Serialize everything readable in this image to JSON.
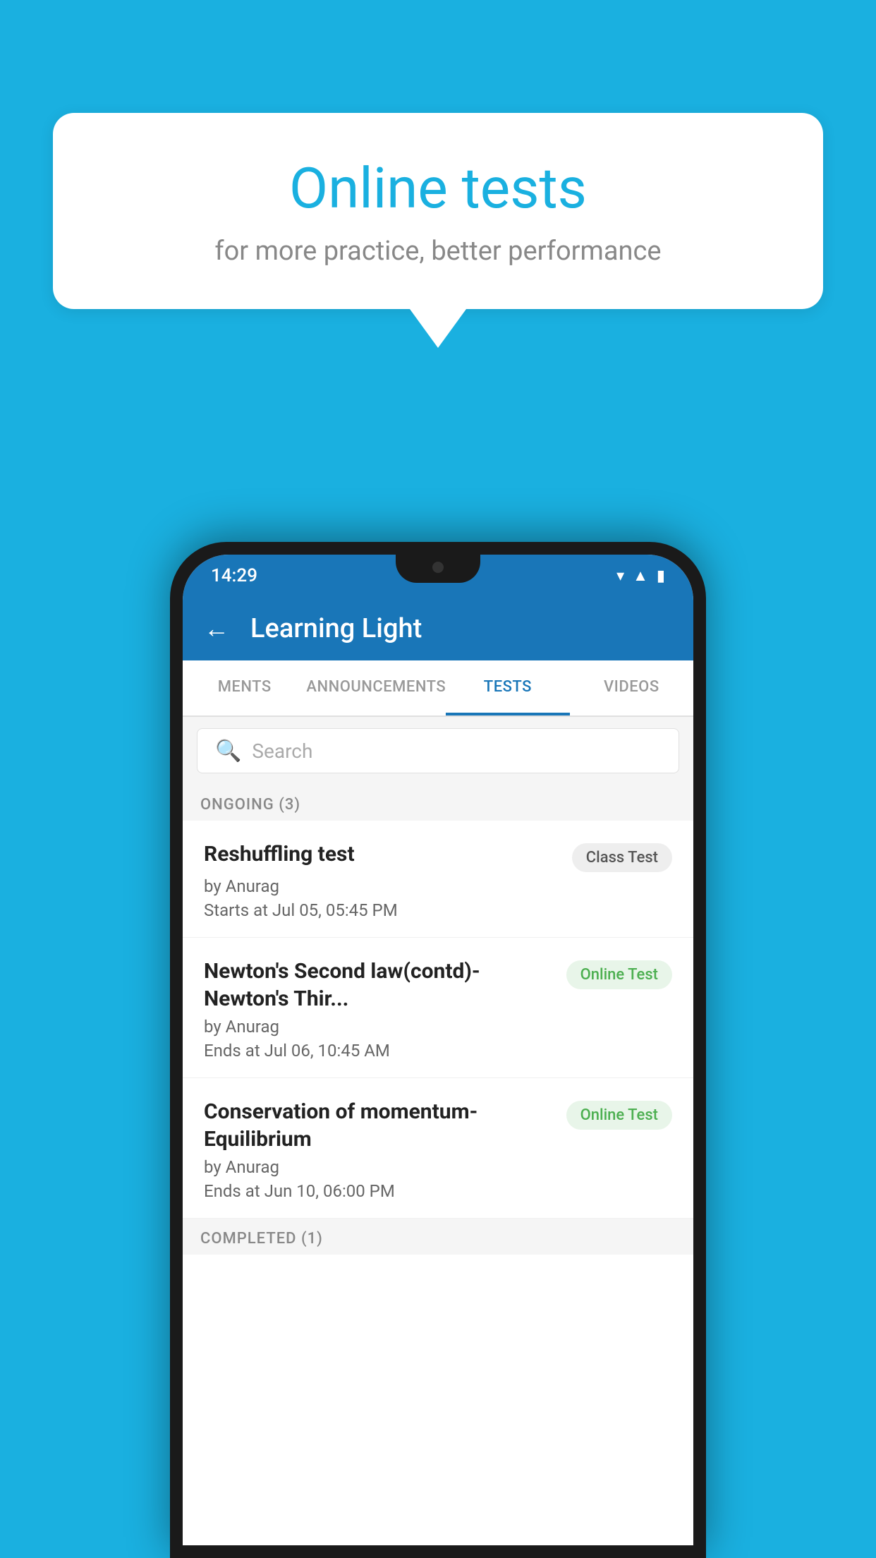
{
  "background_color": "#1ab0e0",
  "speech_bubble": {
    "title": "Online tests",
    "subtitle": "for more practice, better performance"
  },
  "phone": {
    "status_bar": {
      "time": "14:29",
      "icons": [
        "wifi",
        "signal",
        "battery"
      ]
    },
    "app_header": {
      "title": "Learning Light",
      "back_label": "←"
    },
    "tabs": [
      {
        "label": "MENTS",
        "active": false
      },
      {
        "label": "ANNOUNCEMENTS",
        "active": false
      },
      {
        "label": "TESTS",
        "active": true
      },
      {
        "label": "VIDEOS",
        "active": false
      }
    ],
    "search": {
      "placeholder": "Search"
    },
    "ongoing_section": {
      "label": "ONGOING (3)"
    },
    "test_items": [
      {
        "name": "Reshuffling test",
        "badge": "Class Test",
        "badge_type": "class",
        "author": "by Anurag",
        "date": "Starts at  Jul 05, 05:45 PM"
      },
      {
        "name": "Newton's Second law(contd)-Newton's Thir...",
        "badge": "Online Test",
        "badge_type": "online",
        "author": "by Anurag",
        "date": "Ends at  Jul 06, 10:45 AM"
      },
      {
        "name": "Conservation of momentum-Equilibrium",
        "badge": "Online Test",
        "badge_type": "online",
        "author": "by Anurag",
        "date": "Ends at  Jun 10, 06:00 PM"
      }
    ],
    "completed_section": {
      "label": "COMPLETED (1)"
    }
  }
}
